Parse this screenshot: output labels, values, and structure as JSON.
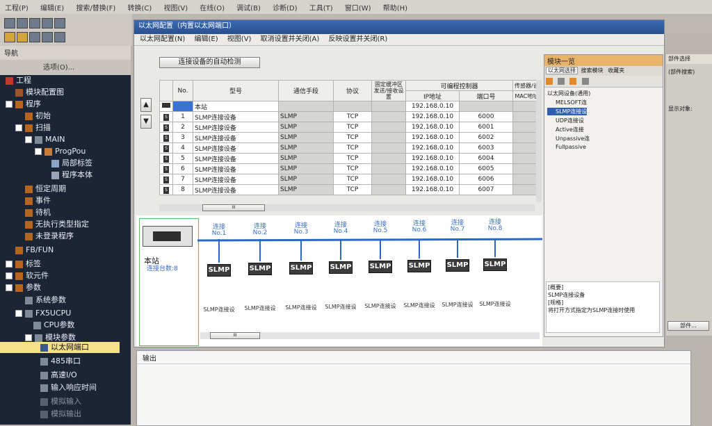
{
  "menubar": {
    "items": [
      "工程(P)",
      "编辑(E)",
      "搜索/替换(F)",
      "转换(C)",
      "视图(V)",
      "在线(O)",
      "调试(B)",
      "诊断(D)",
      "工具(T)",
      "窗口(W)",
      "帮助(H)"
    ]
  },
  "nav": {
    "title": "导航",
    "toolbar_label": "选项(O)...",
    "items": [
      "工程",
      "模块配置图",
      "程序",
      "初始",
      "扫描",
      "MAIN",
      "ProgPou",
      "局部标签",
      "程序本体",
      "恒定周期",
      "事件",
      "待机",
      "无执行类型指定",
      "未登录程序",
      "FB/FUN",
      "标签",
      "软元件",
      "参数",
      "系统参数",
      "FX5UCPU",
      "CPU参数",
      "模块参数",
      "以太网端口",
      "485串口",
      "高速I/O",
      "输入响应时间",
      "模拟输入",
      "模拟输出"
    ]
  },
  "window": {
    "title": "以太网配置（内置以太网端口）",
    "menu": [
      "以太网配置(N)",
      "编辑(E)",
      "视图(V)",
      "取消设置并关闭(A)",
      "反映设置并关闭(R)"
    ],
    "auto_detect": "连接设备的自动检测"
  },
  "table": {
    "headers": {
      "no": "No.",
      "model": "型号",
      "comm": "通信手段",
      "protocol": "协议",
      "fixed": "固定缓冲区发送/接收设置",
      "plc": "可编程控制器",
      "ip": "IP地址",
      "port": "端口号",
      "sensor": "传感器/设",
      "mac": "MAC地址"
    },
    "host": {
      "name": "本站",
      "ip": "192.168.0.10"
    },
    "rows": [
      {
        "no": "1",
        "model": "SLMP连接设备",
        "comm": "SLMP",
        "protocol": "TCP",
        "ip": "192.168.0.10",
        "port": "6000"
      },
      {
        "no": "2",
        "model": "SLMP连接设备",
        "comm": "SLMP",
        "protocol": "TCP",
        "ip": "192.168.0.10",
        "port": "6001"
      },
      {
        "no": "3",
        "model": "SLMP连接设备",
        "comm": "SLMP",
        "protocol": "TCP",
        "ip": "192.168.0.10",
        "port": "6002"
      },
      {
        "no": "4",
        "model": "SLMP连接设备",
        "comm": "SLMP",
        "protocol": "TCP",
        "ip": "192.168.0.10",
        "port": "6003"
      },
      {
        "no": "5",
        "model": "SLMP连接设备",
        "comm": "SLMP",
        "protocol": "TCP",
        "ip": "192.168.0.10",
        "port": "6004"
      },
      {
        "no": "6",
        "model": "SLMP连接设备",
        "comm": "SLMP",
        "protocol": "TCP",
        "ip": "192.168.0.10",
        "port": "6005"
      },
      {
        "no": "7",
        "model": "SLMP连接设备",
        "comm": "SLMP",
        "protocol": "TCP",
        "ip": "192.168.0.10",
        "port": "6006"
      },
      {
        "no": "8",
        "model": "SLMP连接设备",
        "comm": "SLMP",
        "protocol": "TCP",
        "ip": "192.168.0.10",
        "port": "6007"
      }
    ],
    "scroll_glyph": "III"
  },
  "diagram": {
    "host_name": "本站",
    "host_count": "连接台数:8",
    "node_label": "SLMP",
    "connections": [
      {
        "name": "连接",
        "no": "No.1",
        "device": "SLMP连接设"
      },
      {
        "name": "连接",
        "no": "No.2",
        "device": "SLMP连接设"
      },
      {
        "name": "连接",
        "no": "No.3",
        "device": "SLMP连接设"
      },
      {
        "name": "连接",
        "no": "No.4",
        "device": "SLMP连接设"
      },
      {
        "name": "连接",
        "no": "No.5",
        "device": "SLMP连接设"
      },
      {
        "name": "连接",
        "no": "No.6",
        "device": "SLMP连接设"
      },
      {
        "name": "连接",
        "no": "No.7",
        "device": "SLMP连接设"
      },
      {
        "name": "连接",
        "no": "No.8",
        "device": "SLMP连接设"
      }
    ],
    "scroll_glyph": "III"
  },
  "module_list": {
    "title": "模块一览",
    "tabs": [
      "以太网选择",
      "搜索模块",
      "收藏夹"
    ],
    "tree_root": "以太网设备(通用)",
    "items": [
      "MELSOFT连",
      "SLMP连接设",
      "UDP连接设",
      "Active连接",
      "Unpassive连",
      "Fullpassive"
    ],
    "summary_head": "[概要]",
    "summary": "SLMP连接设备",
    "spec_head": "[规格]",
    "spec": "将打开方式指定为SLMP连接时使用"
  },
  "side_panel": {
    "title": "部件选择",
    "search": "(部件搜索)",
    "show": "显示对象:",
    "bottom": "部件..."
  },
  "output": {
    "title": "输出"
  }
}
